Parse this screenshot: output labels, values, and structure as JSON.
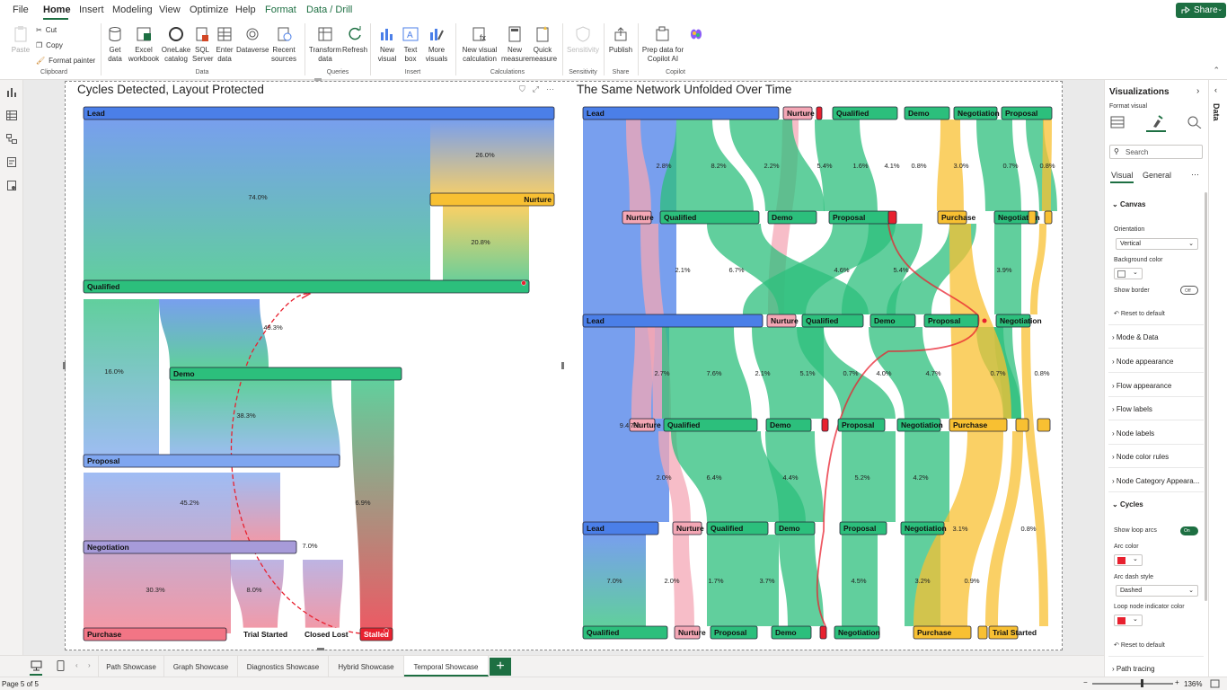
{
  "menu": {
    "items": [
      "File",
      "Home",
      "Insert",
      "Modeling",
      "View",
      "Optimize",
      "Help",
      "Format",
      "Data / Drill"
    ],
    "share": "Share"
  },
  "ribbon": {
    "clipboard": {
      "paste": "Paste",
      "cut": "Cut",
      "copy": "Copy",
      "format_painter": "Format painter",
      "group": "Clipboard"
    },
    "data": {
      "get_data": "Get data",
      "excel": "Excel workbook",
      "onelake": "OneLake catalog",
      "sql": "SQL Server",
      "enter": "Enter data",
      "dataverse": "Dataverse",
      "recent": "Recent sources",
      "group": "Data"
    },
    "queries": {
      "transform": "Transform data",
      "refresh": "Refresh",
      "group": "Queries"
    },
    "insert": {
      "new_visual": "New visual",
      "text_box": "Text box",
      "more_visuals": "More visuals",
      "group": "Insert"
    },
    "calculations": {
      "new_calc": "New visual calculation",
      "new_measure": "New measure",
      "quick_measure": "Quick measure",
      "group": "Calculations"
    },
    "sensitivity": {
      "label": "Sensitivity",
      "group": "Sensitivity"
    },
    "share": {
      "publish": "Publish",
      "group": "Share"
    },
    "copilot": {
      "prep": "Prep data for Copilot AI",
      "group": "Copilot"
    }
  },
  "colors": {
    "brand": "#1d6f42",
    "lead": "#4b7fe8",
    "nurture": "#f4a7b5",
    "qualified": "#2cbf7c",
    "demo": "#2cbf7c",
    "proposal": "#7fa6f0",
    "negotiation": "#a79bd9",
    "purchase": "#f27585",
    "stalled": "#e8212f",
    "nurture_orange": "#f8c032"
  },
  "chart1": {
    "title": "Cycles Detected, Layout Protected",
    "nodes": [
      {
        "label": "Lead",
        "color": "#4b7fe8"
      },
      {
        "label": "Nurture",
        "color": "#f8c032"
      },
      {
        "label": "Qualified",
        "color": "#2cbf7c"
      },
      {
        "label": "Demo",
        "color": "#2cbf7c"
      },
      {
        "label": "Proposal",
        "color": "#7fa6f0"
      },
      {
        "label": "Negotiation",
        "color": "#a79bd9"
      },
      {
        "label": "Purchase",
        "color": "#f27585"
      },
      {
        "label": "Trial Started",
        "color": "#fff"
      },
      {
        "label": "Closed Lost",
        "color": "#fff"
      },
      {
        "label": "Stalled",
        "color": "#e8212f"
      }
    ],
    "flow_labels": [
      "26.0%",
      "74.0%",
      "20.8%",
      "49.3%",
      "16.0%",
      "38.3%",
      "45.2%",
      "6.9%",
      "7.0%",
      "30.3%",
      "8.0%"
    ]
  },
  "chart2": {
    "title": "The Same Network Unfolded Over Time",
    "row_labels": [
      [
        "Lead",
        "Nurture",
        "Qualified",
        "Demo",
        "Negotiation",
        "Proposal"
      ],
      [
        "Nurture",
        "Qualified",
        "Demo",
        "Proposal",
        "Purchase",
        "Negotiation"
      ],
      [
        "Lead",
        "Nurture",
        "Qualified",
        "Demo",
        "Proposal",
        "Negotiation"
      ],
      [
        "Nurture",
        "Qualified",
        "Demo",
        "Proposal",
        "Negotiation",
        "Purchase"
      ],
      [
        "Lead",
        "Nurture",
        "Qualified",
        "Demo",
        "Proposal",
        "Negotiation"
      ],
      [
        "Qualified",
        "Nurture",
        "Proposal",
        "Demo",
        "Negotiation",
        "Purchase",
        "Trial Started"
      ]
    ],
    "flow_labels": [
      [
        "2.8%",
        "8.2%",
        "2.2%",
        "5.4%",
        "1.6%",
        "4.1%",
        "0.8%",
        "3.0%",
        "0.7%",
        "0.8%"
      ],
      [
        "2.1%",
        "6.7%",
        "4.6%",
        "5.4%",
        "3.9%"
      ],
      [
        "2.7%",
        "7.6%",
        "2.1%",
        "5.1%",
        "0.7%",
        "4.0%",
        "4.7%",
        "0.7%",
        "0.8%"
      ],
      [
        "2.0%",
        "6.4%",
        "4.4%",
        "5.2%",
        "4.2%"
      ],
      [
        "7.0%",
        "2.0%",
        "1.7%",
        "3.7%",
        "4.5%",
        "3.2%",
        "0.9%"
      ],
      [
        "9.4",
        "7%",
        "3.1%",
        "0.8%"
      ]
    ]
  },
  "viz_panel": {
    "title": "Visualizations",
    "format_visual": "Format visual",
    "search_placeholder": "Search",
    "tabs": [
      "Visual",
      "General"
    ],
    "canvas": "Canvas",
    "orientation_label": "Orientation",
    "orientation_value": "Vertical",
    "bg_color_label": "Background color",
    "show_border": "Show border",
    "toggle_off": "Off",
    "reset": "Reset to default",
    "sections": [
      "Mode & Data",
      "Node appearance",
      "Flow appearance",
      "Flow labels",
      "Node labels",
      "Node color rules",
      "Node Category Appeara..."
    ],
    "cycles": "Cycles",
    "show_loop_arcs": "Show loop arcs",
    "toggle_on": "On",
    "arc_color": "Arc color",
    "arc_dash_style": "Arc dash style",
    "arc_dash_value": "Dashed",
    "loop_indicator": "Loop node indicator color",
    "path_tracing": "Path tracing",
    "arc_color_hex": "#e8212f"
  },
  "data_tab": "Data",
  "page_tabs": [
    "Path Showcase",
    "Graph Showcase",
    "Diagnostics Showcase",
    "Hybrid Showcase",
    "Temporal Showcase"
  ],
  "active_tab": "Temporal Showcase",
  "status": {
    "page": "Page 5 of 5",
    "zoom": "136%"
  }
}
